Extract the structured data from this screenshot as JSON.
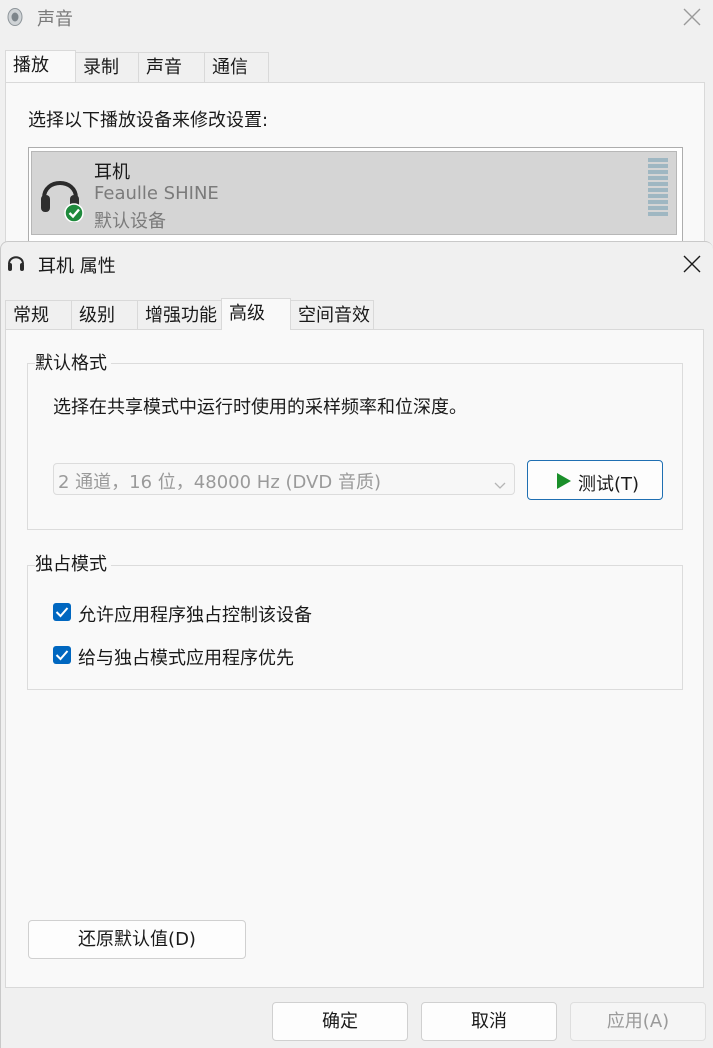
{
  "sound_window": {
    "title": "声音",
    "tabs": [
      "播放",
      "录制",
      "声音",
      "通信"
    ],
    "instruction": "选择以下播放设备来修改设置:",
    "device": {
      "name": "耳机",
      "model": "Feaulle SHINE",
      "status": "默认设备"
    }
  },
  "properties_dialog": {
    "title": "耳机 属性",
    "tabs": [
      "常规",
      "级别",
      "增强功能",
      "高级",
      "空间音效"
    ],
    "active_tab": "高级",
    "default_format": {
      "group_label": "默认格式",
      "description": "选择在共享模式中运行时使用的采样频率和位深度。",
      "selected_format": "2 通道，16 位，48000 Hz (DVD 音质)",
      "test_button": "测试(T)"
    },
    "exclusive_mode": {
      "group_label": "独占模式",
      "options": [
        {
          "label": "允许应用程序独占控制该设备",
          "checked": true
        },
        {
          "label": "给与独占模式应用程序优先",
          "checked": true
        }
      ]
    },
    "restore_defaults_button": "还原默认值(D)",
    "footer": {
      "ok": "确定",
      "cancel": "取消",
      "apply": "应用(A)"
    }
  },
  "colors": {
    "accent": "#0067c0",
    "play_icon": "#1a8f2a",
    "check_badge": "#1e8a3c"
  }
}
